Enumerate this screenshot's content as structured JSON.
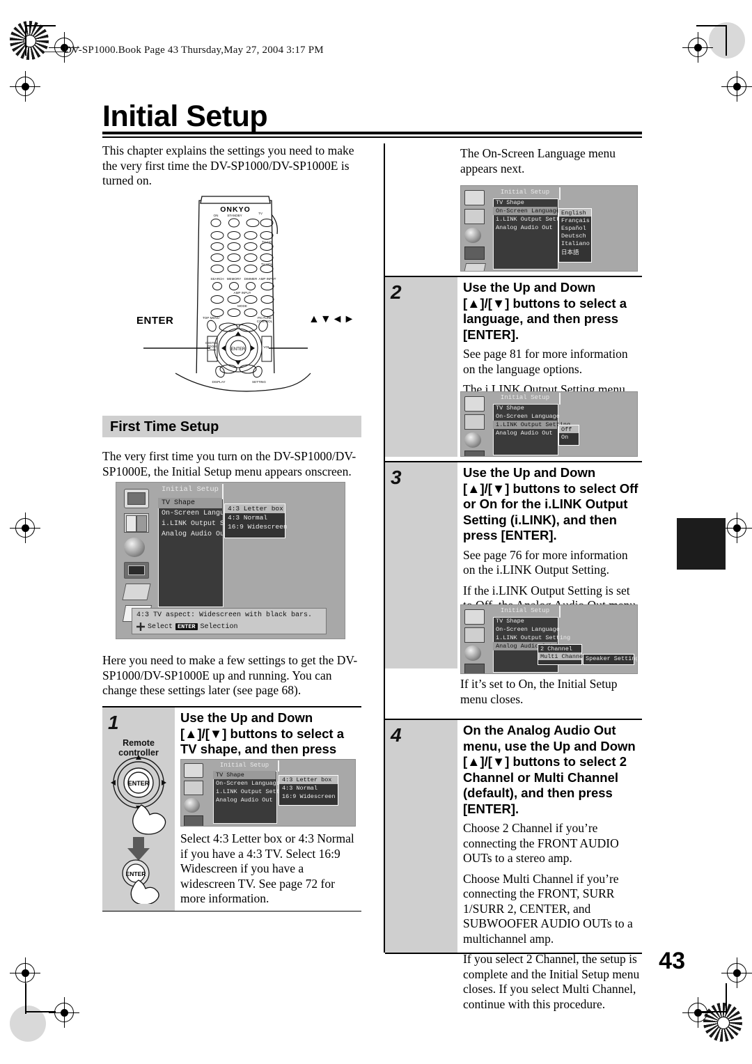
{
  "header": {
    "running_head": "DV-SP1000.Book  Page 43  Thursday,May 27, 2004  3:17 PM"
  },
  "title": "Initial Setup",
  "page_number": "43",
  "left_column": {
    "intro": "This chapter explains the settings you need to make the very first time the DV-SP1000/DV-SP1000E is turned on.",
    "remote": {
      "brand": "ONKYO",
      "enter_label": "ENTER",
      "arrows_label": "▲▼◄►"
    },
    "section_heading": "First Time Setup",
    "section_intro": "The very first time you turn on the DV-SP1000/DV-SP1000E, the Initial Setup menu appears onscreen.",
    "after_screenshot": "Here you need to make a few settings to get the DV-SP1000/DV-SP1000E up and running. You can change these settings later (see page 68)."
  },
  "osd_main": {
    "title": "Initial Setup",
    "items": [
      "TV Shape",
      "On-Screen Language",
      "i.LINK Output Setting",
      "Analog Audio Out"
    ],
    "selected_item": "TV Shape",
    "submenu": [
      "4:3 Letter box",
      "4:3 Normal",
      "16:9 Widescreen"
    ],
    "submenu_selected": "4:3 Letter box",
    "help_text": "4:3 TV aspect: Widescreen with black bars.",
    "footer_select": "Select",
    "footer_enter_badge": "ENTER",
    "footer_selection": "Selection"
  },
  "osd_language": {
    "title": "Initial Setup",
    "items": [
      "TV Shape",
      "On-Screen Language",
      "i.LINK Output Setting",
      "Analog Audio Out"
    ],
    "selected_item": "On-Screen Language",
    "submenu": [
      "English",
      "Français",
      "Español",
      "Deutsch",
      "Italiano",
      "日本語"
    ],
    "submenu_selected": "English"
  },
  "osd_ilink": {
    "title": "Initial Setup",
    "items": [
      "TV Shape",
      "On-Screen Language",
      "i.LINK Output Setting",
      "Analog Audio Out"
    ],
    "selected_item": "i.LINK Output Setting",
    "submenu": [
      "Off",
      "On"
    ],
    "submenu_selected": "Off"
  },
  "osd_analog": {
    "title": "Initial Setup",
    "items": [
      "TV Shape",
      "On-Screen Language",
      "i.LINK Output Setting",
      "Analog Audio Out"
    ],
    "selected_item": "Analog Audio Out",
    "submenu": [
      "2 Channel",
      "Multi Channel"
    ],
    "submenu_selected": "Multi Channel",
    "extra_button": "Speaker Setting"
  },
  "steps": [
    {
      "number": "1",
      "device_label": "Remote controller",
      "heading": "Use the Up and Down [▲]/[▼] buttons to select a TV shape, and then press [ENTER].",
      "paragraphs": [
        "Select 4:3 Letter box or 4:3 Normal if you have a 4:3 TV. Select 16:9 Widescreen if you have a widescreen TV. See page 72 for more information."
      ]
    },
    {
      "number": "2",
      "heading": "Use the Up and Down [▲]/[▼] buttons to select a language, and then press [ENTER].",
      "paragraphs": [
        "See page 81 for more information on the language options.",
        "The i.LINK Output Setting menu appears next."
      ]
    },
    {
      "number": "3",
      "heading": "Use the Up and Down [▲]/[▼] buttons to select Off or On for the i.LINK Output Setting (i.LINK), and then press [ENTER].",
      "paragraphs": [
        "See page 76 for more information on the i.LINK Output Setting.",
        "If the i.LINK Output Setting is set to Off, the Analog Audio Out menu appears next."
      ]
    },
    {
      "number": "4",
      "heading": "On the Analog Audio Out menu, use the Up and Down [▲]/[▼] buttons to select 2 Channel or Multi Channel (default), and then press [ENTER].",
      "paragraphs": [
        "Choose 2 Channel if you’re connecting the FRONT AUDIO OUTs to a stereo amp.",
        "Choose Multi Channel if you’re connecting the FRONT, SURR 1/SURR 2, CENTER, and SUBWOOFER AUDIO OUTs to a multichannel amp.",
        "If you select 2 Channel, the setup is complete and the Initial Setup menu closes. If you select Multi Channel, continue with this procedure."
      ]
    }
  ],
  "right_column": {
    "top_text": "The On-Screen Language menu appears next.",
    "after_analog_screenshot": "If it’s set to On, the Initial Setup menu closes."
  }
}
